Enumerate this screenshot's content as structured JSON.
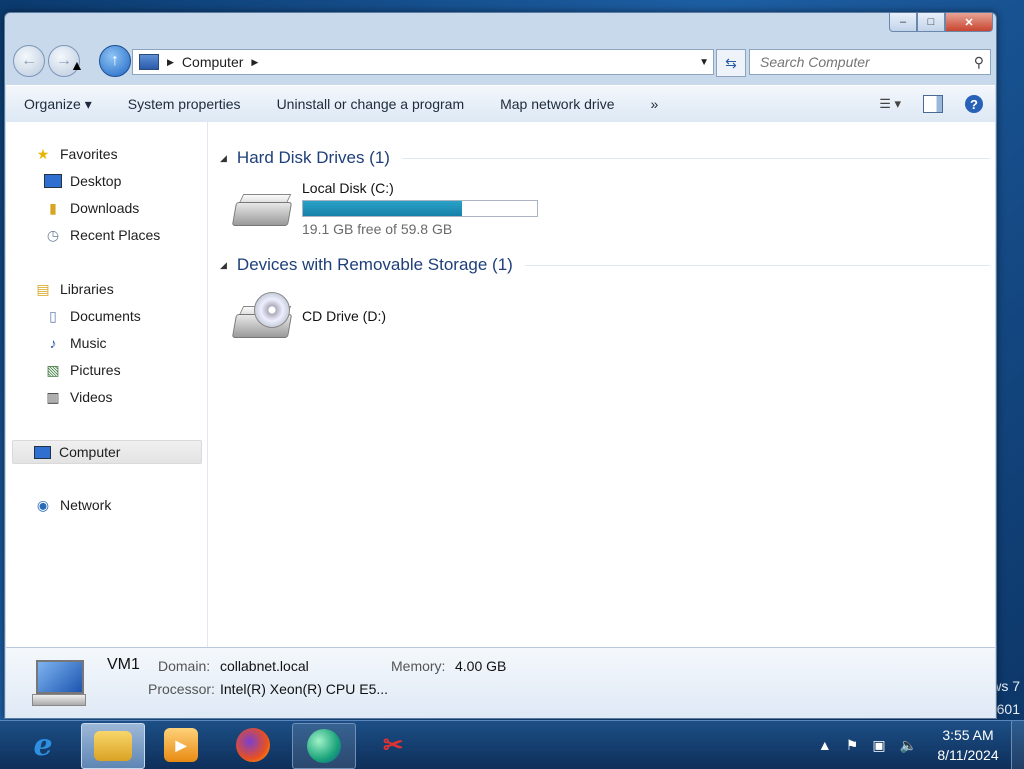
{
  "desktop": {
    "watermark_line1": "ws 7",
    "watermark_line2": "601"
  },
  "window": {
    "caption": {
      "minimize": "–",
      "maximize": "□",
      "close": "✕"
    },
    "address": {
      "location": "Computer"
    },
    "search": {
      "placeholder": "Search Computer"
    },
    "toolbar": {
      "organize": "Organize ▾",
      "system_properties": "System properties",
      "uninstall": "Uninstall or change a program",
      "map_drive": "Map network drive",
      "more": "»"
    },
    "nav": {
      "favorites": "Favorites",
      "desktop": "Desktop",
      "downloads": "Downloads",
      "recent": "Recent Places",
      "libraries": "Libraries",
      "documents": "Documents",
      "music": "Music",
      "pictures": "Pictures",
      "videos": "Videos",
      "computer": "Computer",
      "network": "Network"
    },
    "groups": {
      "hdd": "Hard Disk Drives (1)",
      "removable": "Devices with Removable Storage (1)"
    },
    "drives": {
      "c_name": "Local Disk (C:)",
      "c_free": "19.1 GB free of 59.8 GB",
      "c_used_fraction": 0.68,
      "d_name": "CD Drive (D:)"
    },
    "details": {
      "name": "VM1",
      "domain_label": "Domain:",
      "domain": "collabnet.local",
      "memory_label": "Memory:",
      "memory": "4.00 GB",
      "processor_label": "Processor:",
      "processor": "Intel(R) Xeon(R) CPU E5..."
    }
  },
  "taskbar": {
    "clock_time": "3:55 AM",
    "clock_date": "8/11/2024"
  },
  "colors": {
    "accent": "#1e3f7a",
    "bar_fill": "#1a8ab5"
  }
}
